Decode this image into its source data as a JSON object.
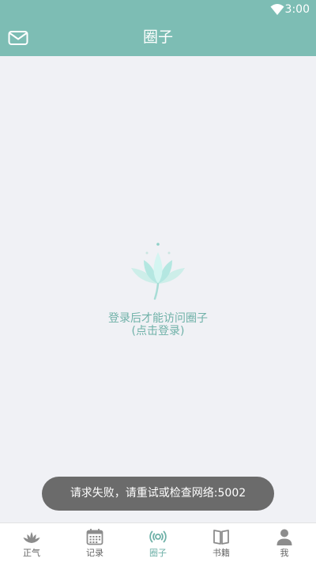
{
  "status_bar": {
    "time": "3:00"
  },
  "header": {
    "title": "圈子"
  },
  "empty_state": {
    "line1": "登录后才能访问圈子",
    "line2": "(点击登录)"
  },
  "toast": {
    "message": "请求失败，请重试或检查网络:5002"
  },
  "tabs": [
    {
      "label": "正气",
      "icon": "lotus-icon"
    },
    {
      "label": "记录",
      "icon": "calendar-icon"
    },
    {
      "label": "圈子",
      "icon": "broadcast-icon",
      "active": true
    },
    {
      "label": "书籍",
      "icon": "book-icon"
    },
    {
      "label": "我",
      "icon": "person-icon"
    }
  ],
  "colors": {
    "primary": "#7dbdb4",
    "accent": "#6fb1a8",
    "background": "#f0f1f5"
  }
}
